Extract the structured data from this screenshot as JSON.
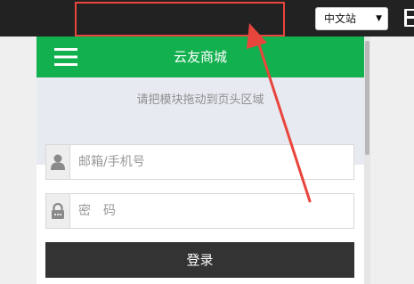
{
  "toolbar": {
    "language_select": {
      "selected": "中文站"
    }
  },
  "app": {
    "title": "云友商城",
    "drop_zone_text": "请把模块拖动到页头区域",
    "email_placeholder": "邮箱/手机号",
    "password_placeholder": "密　码",
    "login_label": "登录"
  },
  "icons": {
    "menu": "menu-icon",
    "user": "user-icon",
    "lock": "lock-icon",
    "save": "save-icon"
  },
  "colors": {
    "header_green": "#12b04e",
    "toolbar_dark": "#222222",
    "login_button": "#333333",
    "annotation_red": "#e8453c"
  }
}
